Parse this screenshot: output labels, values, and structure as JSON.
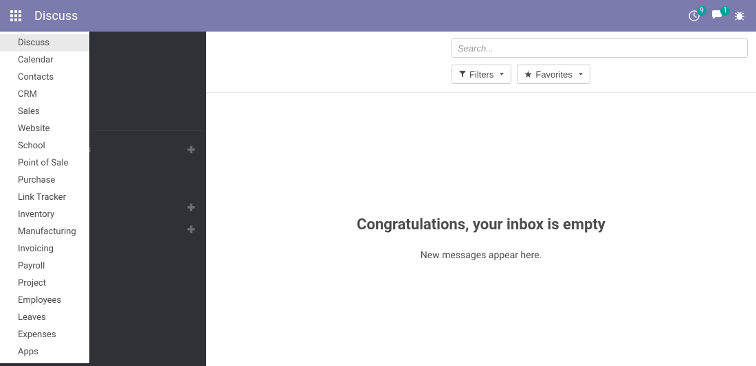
{
  "topbar": {
    "title": "Discuss",
    "timer_badge": "9",
    "chat_badge": "1"
  },
  "app_menu": {
    "items": [
      {
        "label": "Discuss",
        "active": true
      },
      {
        "label": "Calendar"
      },
      {
        "label": "Contacts"
      },
      {
        "label": "CRM"
      },
      {
        "label": "Sales"
      },
      {
        "label": "Website"
      },
      {
        "label": "School"
      },
      {
        "label": "Point of Sale"
      },
      {
        "label": "Purchase"
      },
      {
        "label": "Link Tracker"
      },
      {
        "label": "Inventory"
      },
      {
        "label": "Manufacturing"
      },
      {
        "label": "Invoicing"
      },
      {
        "label": "Payroll"
      },
      {
        "label": "Project"
      },
      {
        "label": "Employees"
      },
      {
        "label": "Leaves"
      },
      {
        "label": "Expenses"
      },
      {
        "label": "Apps"
      }
    ]
  },
  "sidebar": {
    "peek_text": "ks"
  },
  "controls": {
    "search_placeholder": "Search...",
    "filters_label": "Filters",
    "favorites_label": "Favorites"
  },
  "empty": {
    "title": "Congratulations, your inbox is empty",
    "subtitle": "New messages appear here."
  }
}
